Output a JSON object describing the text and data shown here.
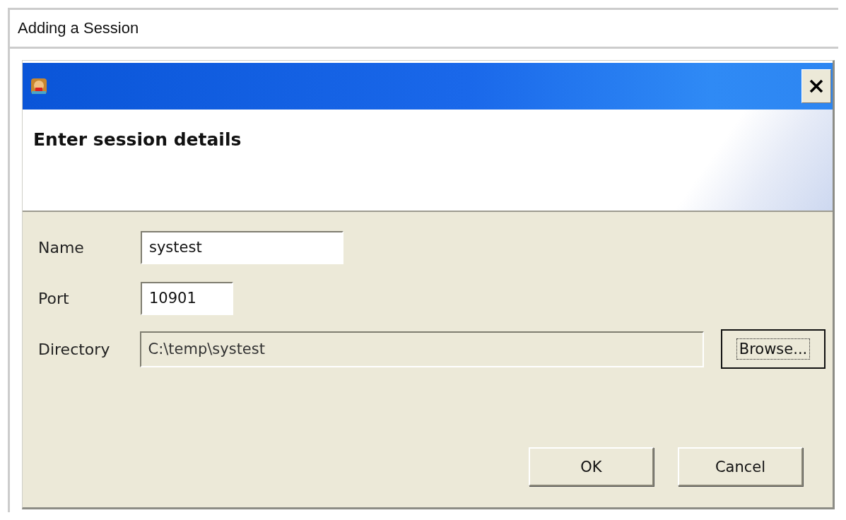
{
  "page": {
    "heading": "Adding a Session"
  },
  "dialog": {
    "banner_title": "Enter session details",
    "fields": [
      {
        "label": "Name",
        "value": "systest",
        "disabled": false
      },
      {
        "label": "Port",
        "value": "10901",
        "disabled": false
      },
      {
        "label": "Directory",
        "value": "C:\\temp\\systest",
        "disabled": true,
        "button": {
          "label": "Browse...",
          "focused": true
        }
      }
    ],
    "buttons": [
      {
        "label": "OK",
        "focused": false
      },
      {
        "label": "Cancel",
        "focused": false
      }
    ]
  }
}
